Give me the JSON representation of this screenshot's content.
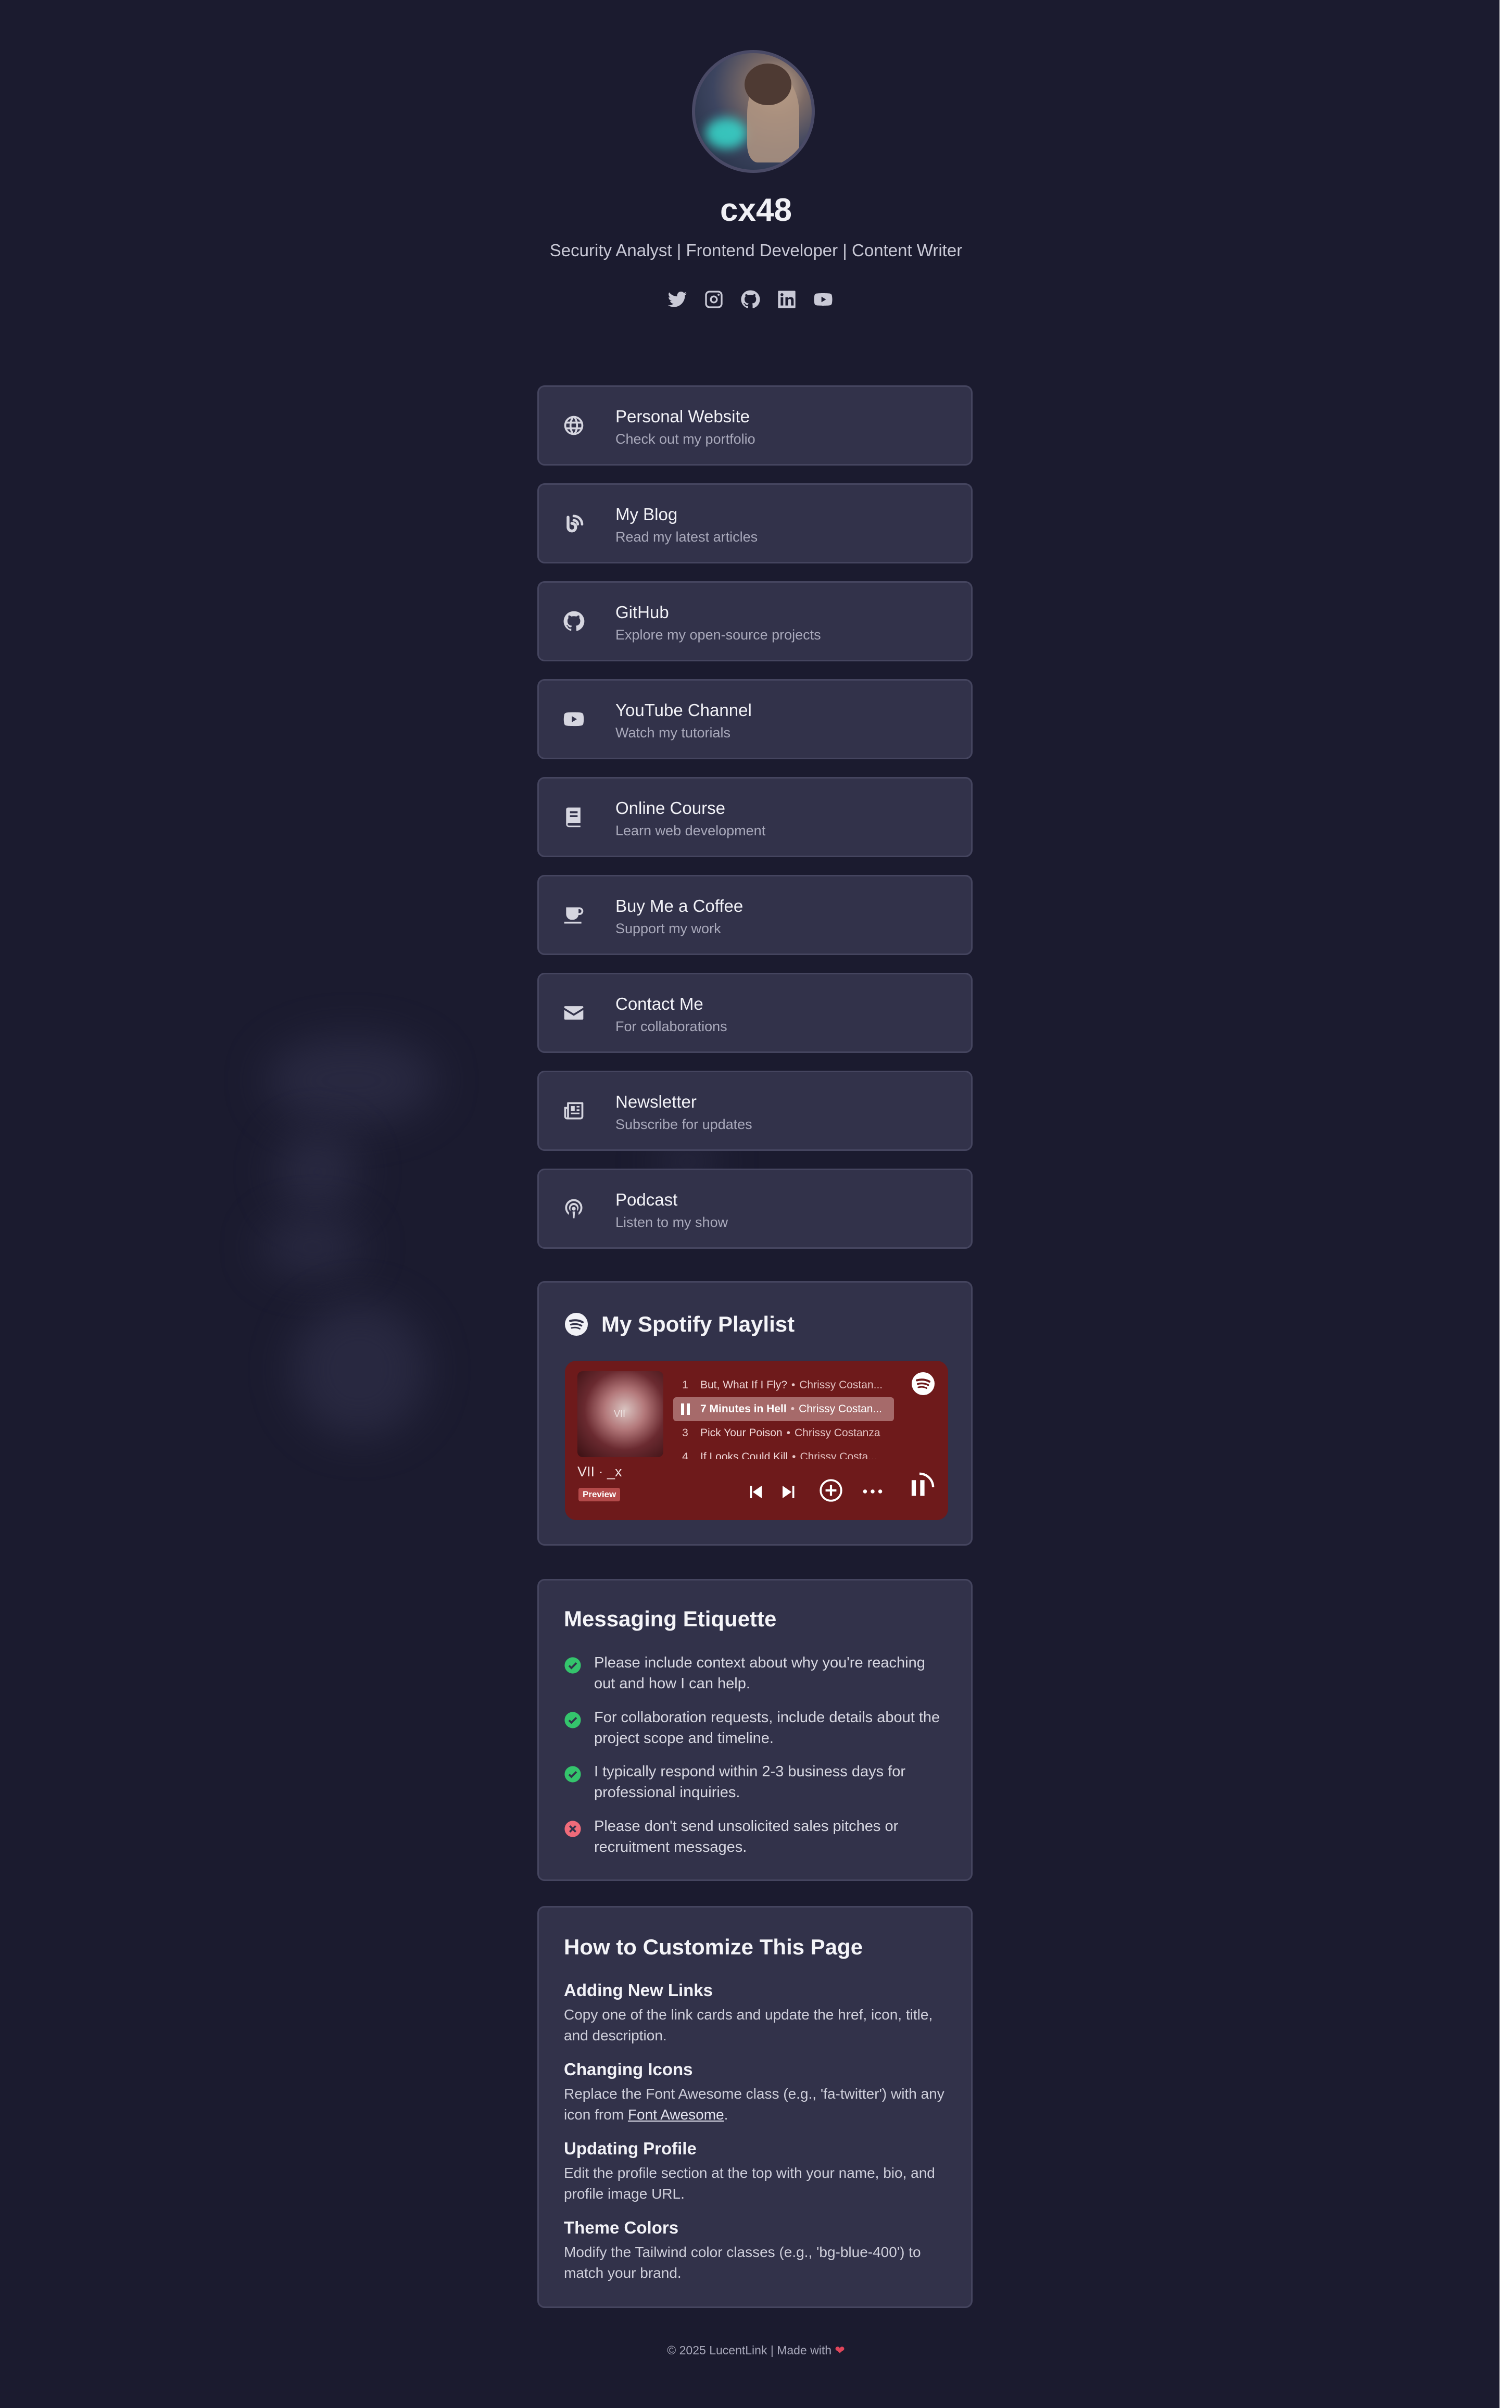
{
  "profile": {
    "name": "cx48",
    "bio": "Security Analyst | Frontend Developer | Content Writer"
  },
  "socials": [
    {
      "icon": "twitter-icon"
    },
    {
      "icon": "instagram-icon"
    },
    {
      "icon": "github-icon"
    },
    {
      "icon": "linkedin-icon"
    },
    {
      "icon": "youtube-icon"
    }
  ],
  "links": [
    {
      "icon": "globe-icon",
      "title": "Personal Website",
      "desc": "Check out my portfolio"
    },
    {
      "icon": "blog-icon",
      "title": "My Blog",
      "desc": "Read my latest articles"
    },
    {
      "icon": "github-icon",
      "title": "GitHub",
      "desc": "Explore my open-source projects"
    },
    {
      "icon": "youtube-icon",
      "title": "YouTube Channel",
      "desc": "Watch my tutorials"
    },
    {
      "icon": "book-icon",
      "title": "Online Course",
      "desc": "Learn web development"
    },
    {
      "icon": "coffee-icon",
      "title": "Buy Me a Coffee",
      "desc": "Support my work"
    },
    {
      "icon": "envelope-icon",
      "title": "Contact Me",
      "desc": "For collaborations"
    },
    {
      "icon": "newspaper-icon",
      "title": "Newsletter",
      "desc": "Subscribe for updates"
    },
    {
      "icon": "podcast-icon",
      "title": "Podcast",
      "desc": "Listen to my show"
    }
  ],
  "spotify": {
    "title": "My Spotify Playlist",
    "album": "VII · _x",
    "preview": "Preview",
    "tracks": [
      {
        "n": "1",
        "title": "But, What If I Fly?",
        "artist": "Chrissy Costan..."
      },
      {
        "n": "",
        "title": "7 Minutes in Hell",
        "artist": "Chrissy Costan..."
      },
      {
        "n": "3",
        "title": "Pick Your Poison",
        "artist": "Chrissy Costanza"
      },
      {
        "n": "4",
        "title": "If Looks Could Kill",
        "artist": "Chrissy Costa..."
      }
    ],
    "colors": {
      "embed_bg": "#6e1a1b",
      "active_row": "#a66a6a"
    }
  },
  "etiquette": {
    "title": "Messaging Etiquette",
    "rules": [
      {
        "status": "do",
        "icon": "check-circle-icon",
        "text": "Please include context about why you're reaching out and how I can help."
      },
      {
        "status": "do",
        "icon": "check-circle-icon",
        "text": "For collaboration requests, include details about the project scope and timeline."
      },
      {
        "status": "do",
        "icon": "check-circle-icon",
        "text": "I typically respond within 2-3 business days for professional inquiries."
      },
      {
        "status": "dont",
        "icon": "x-circle-icon",
        "text": "Please don't send unsolicited sales pitches or recruitment messages."
      }
    ],
    "colors": {
      "do": "#34c46c",
      "dont": "#f06b7a"
    }
  },
  "customize": {
    "title": "How to Customize This Page",
    "sections": [
      {
        "heading": "Adding New Links",
        "text": "Copy one of the link cards and update the href, icon, title, and description."
      },
      {
        "heading": "Changing Icons",
        "text_before": "Replace the Font Awesome class (e.g., 'fa-twitter') with any icon from ",
        "link": "Font Awesome",
        "text_after": "."
      },
      {
        "heading": "Updating Profile",
        "text": "Edit the profile section at the top with your name, bio, and profile image URL."
      },
      {
        "heading": "Theme Colors",
        "text": "Modify the Tailwind color classes (e.g., 'bg-blue-400') to match your brand."
      }
    ]
  },
  "footer": {
    "text": "© 2025 LucentLink | Made with",
    "icon": "heart-icon"
  },
  "theme": {
    "background": "#1b1b2f",
    "card": "#32324a",
    "card_border": "#45455f"
  }
}
